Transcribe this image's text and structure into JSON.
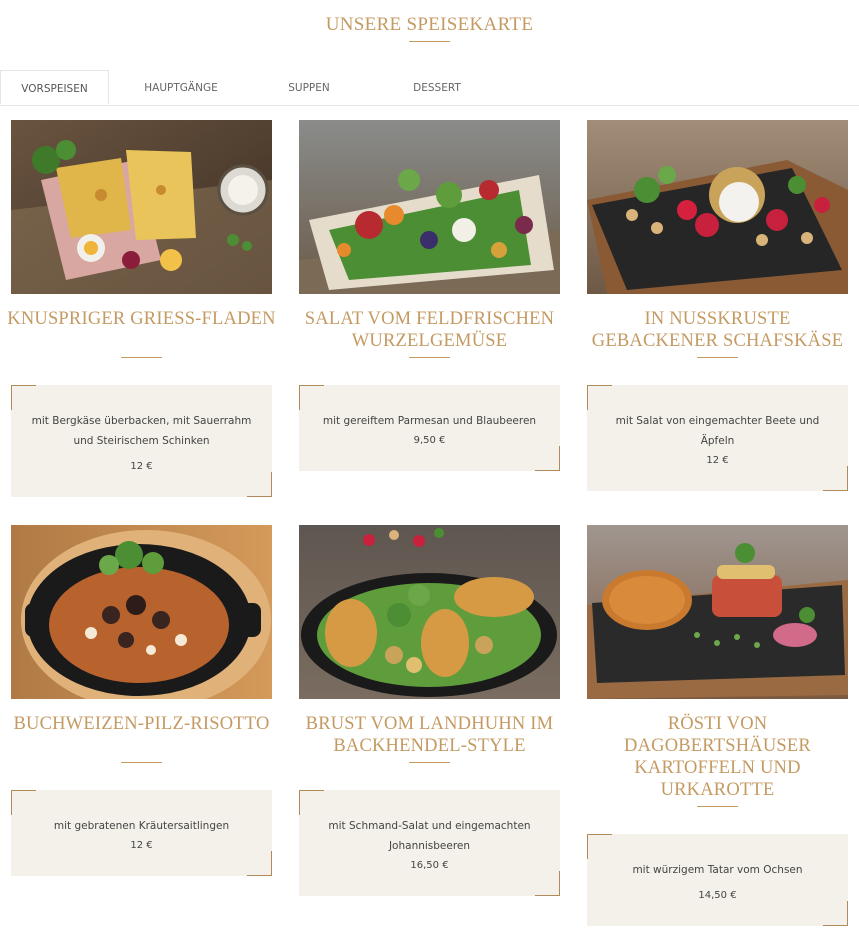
{
  "page": {
    "title": "UNSERE SPEISEKARTE"
  },
  "tabs": [
    {
      "label": "VORSPEISEN",
      "active": true
    },
    {
      "label": "HAUPTGÄNGE",
      "active": false
    },
    {
      "label": "SUPPEN",
      "active": false
    },
    {
      "label": "DESSERT",
      "active": false
    }
  ],
  "dishes": [
    {
      "title": "KNUSPRIGER GRIESS-FLADEN",
      "description": "mit Bergkäse überbacken, mit Sauerrahm und Steirischem Schinken",
      "price": "12 €"
    },
    {
      "title": "SALAT VOM FELDFRISCHEN WURZELGEMÜSE",
      "description": "mit gereiftem Parmesan und Blaubeeren",
      "price": "9,50 €"
    },
    {
      "title": "IN NUSSKRUSTE GEBACKENER SCHAFSKÄSE",
      "description": "mit Salat von eingemachter Beete und Äpfeln",
      "price": "12 €"
    },
    {
      "title": "BUCHWEIZEN-PILZ-RISOTTO",
      "description": "mit gebratenen Kräutersaitlingen",
      "price": "12 €"
    },
    {
      "title": "BRUST VOM LANDHUHN IM BACKHENDEL-STYLE",
      "description": "mit Schmand-Salat und eingemachten Johannisbeeren",
      "price": "16,50 €"
    },
    {
      "title": "RÖSTI VON DAGOBERTSHÄUSER KARTOFFELN UND URKAROTTE",
      "description": "mit würzigem Tatar vom Ochsen",
      "price": "14,50 €"
    }
  ],
  "colors": {
    "accent": "#c49a62",
    "box": "#f4f1ea",
    "corner": "#b18a5b"
  }
}
